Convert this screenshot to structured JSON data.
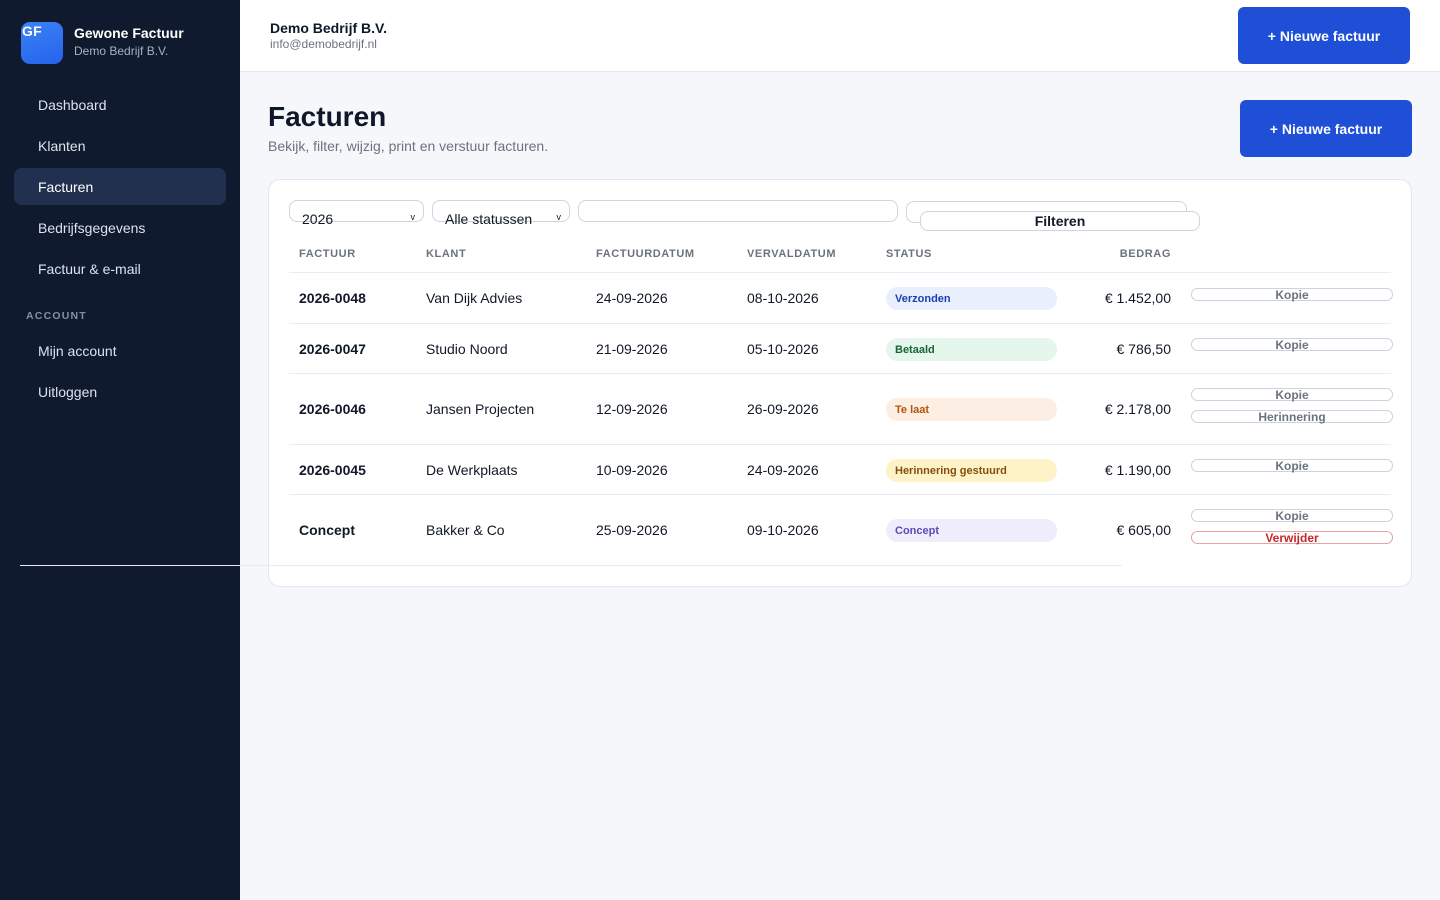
{
  "brand": {
    "logo_text": "GF",
    "name": "Gewone Factuur",
    "company": "Demo Bedrijf B.V."
  },
  "nav": {
    "items": [
      {
        "label": "Dashboard"
      },
      {
        "label": "Klanten"
      },
      {
        "label": "Facturen",
        "active": true
      },
      {
        "label": "Bedrijfsgegevens"
      },
      {
        "label": "Factuur & e-mail"
      }
    ],
    "account_section": "ACCOUNT",
    "account_items": [
      {
        "label": "Mijn account"
      },
      {
        "label": "Uitloggen"
      }
    ]
  },
  "header": {
    "company_name": "Demo Bedrijf B.V.",
    "company_email": "info@demobedrijf.nl",
    "new_invoice_label": "+ Nieuwe factuur"
  },
  "page": {
    "title": "Facturen",
    "subtitle": "Bekijk, filter, wijzig, print en verstuur facturen.",
    "new_invoice_label": "+ Nieuwe factuur"
  },
  "filters": {
    "year": "2026",
    "status": "Alle statussen",
    "search_value": "",
    "filter_label": "Filteren"
  },
  "table": {
    "columns": {
      "invoice": "FACTUUR",
      "client": "KLANT",
      "invoice_date": "FACTUURDATUM",
      "due_date": "VERVALDATUM",
      "status": "STATUS",
      "amount": "BEDRAG"
    },
    "rows": [
      {
        "number": "2026-0048",
        "client": "Van Dijk Advies",
        "invoice_date": "24-09-2026",
        "due_date": "08-10-2026",
        "status": "Verzonden",
        "status_bg": "#e8effd",
        "status_color": "#1e40af",
        "amount": "€ 1.452,00",
        "actions": [
          "Kopie"
        ]
      },
      {
        "number": "2026-0047",
        "client": "Studio Noord",
        "invoice_date": "21-09-2026",
        "due_date": "05-10-2026",
        "status": "Betaald",
        "status_bg": "#e5f6ec",
        "status_color": "#166534",
        "amount": "€ 786,50",
        "actions": [
          "Kopie"
        ]
      },
      {
        "number": "2026-0046",
        "client": "Jansen Projecten",
        "invoice_date": "12-09-2026",
        "due_date": "26-09-2026",
        "status": "Te laat",
        "status_bg": "#fdeee3",
        "status_color": "#b45309",
        "amount": "€ 2.178,00",
        "actions": [
          "Kopie",
          "Herinnering"
        ]
      },
      {
        "number": "2026-0045",
        "client": "De Werkplaats",
        "invoice_date": "10-09-2026",
        "due_date": "24-09-2026",
        "status": "Herinnering gestuurd",
        "status_bg": "#fdf3c7",
        "status_color": "#854d0e",
        "amount": "€ 1.190,00",
        "actions": [
          "Kopie"
        ]
      },
      {
        "number": "Concept",
        "client": "Bakker & Co",
        "invoice_date": "25-09-2026",
        "due_date": "09-10-2026",
        "status": "Concept",
        "status_bg": "#efecfb",
        "status_color": "#5b4bb7",
        "amount": "€ 605,00",
        "actions": [
          "Kopie",
          "Verwijder"
        ]
      }
    ]
  }
}
